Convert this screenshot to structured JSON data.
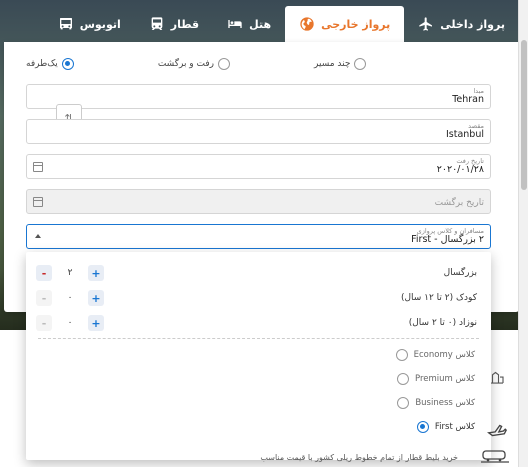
{
  "tabs": [
    {
      "label": "پرواز داخلی",
      "icon": "airplane-icon",
      "active": false
    },
    {
      "label": "پرواز خارجی",
      "icon": "globe-icon",
      "active": true
    },
    {
      "label": "هتل",
      "icon": "bed-icon",
      "active": false
    },
    {
      "label": "قطار",
      "icon": "train-icon",
      "active": false
    },
    {
      "label": "اتوبوس",
      "icon": "bus-icon",
      "active": false
    }
  ],
  "trip_type": {
    "options": [
      "یک‌طرفه",
      "رفت و برگشت",
      "چند مسیر"
    ],
    "selected": "یک‌طرفه"
  },
  "origin": {
    "label": "مبدا",
    "value": "Tehran"
  },
  "destination": {
    "label": "مقصد",
    "value": "Istanbul"
  },
  "swap_icon": "swap-icon",
  "depart_date": {
    "label": "تاریخ رفت",
    "value": "۲۰۲۰/۰۱/۲۸"
  },
  "return_date": {
    "placeholder": "تاریخ برگشت"
  },
  "passengers": {
    "label": "مسافران و کلاس پروازی",
    "value": "۲ بزرگسال - First",
    "rows": [
      {
        "label": "بزرگسال",
        "count": "۲"
      },
      {
        "label": "کودک (۲ تا ۱۲ سال)",
        "count": "۰"
      },
      {
        "label": "نوزاد (۰ تا ۲ سال)",
        "count": "۰"
      }
    ],
    "classes": [
      "کلاس Economy",
      "کلاس Premium",
      "کلاس Business",
      "کلاس First"
    ],
    "selected_class": "کلاس First"
  },
  "promo_text": "خرید بلیط قطار از تمام خطوط ریلی کشور با قیمت مناسب",
  "colors": {
    "accent": "#e8762c",
    "primary": "#1976d2"
  }
}
